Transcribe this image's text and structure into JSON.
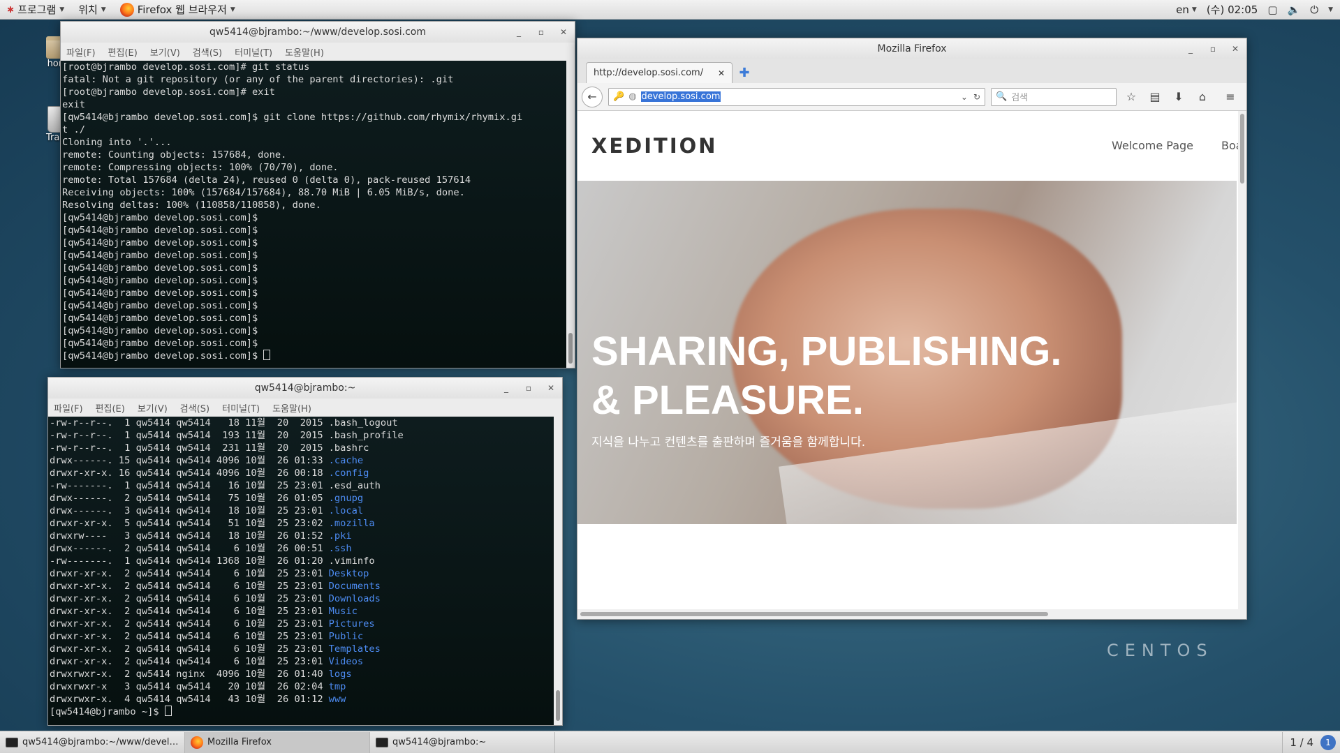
{
  "top_panel": {
    "applications": "프로그램",
    "places": "위치",
    "active_app": "Firefox 웹 브라우저",
    "lang": "en",
    "clock": "(수) 02:05"
  },
  "desktop": {
    "home_label": "home",
    "trash_label": "Trash",
    "centos": "CENTOS"
  },
  "terminal1": {
    "title": "qw5414@bjrambo:~/www/develop.sosi.com",
    "menu": [
      "파일(F)",
      "편집(E)",
      "보기(V)",
      "검색(S)",
      "터미널(T)",
      "도움말(H)"
    ],
    "lines": [
      "[root@bjrambo develop.sosi.com]# git status",
      "fatal: Not a git repository (or any of the parent directories): .git",
      "[root@bjrambo develop.sosi.com]# exit",
      "exit",
      "[qw5414@bjrambo develop.sosi.com]$ git clone https://github.com/rhymix/rhymix.gi",
      "t ./",
      "Cloning into '.'...",
      "remote: Counting objects: 157684, done.",
      "remote: Compressing objects: 100% (70/70), done.",
      "remote: Total 157684 (delta 24), reused 0 (delta 0), pack-reused 157614",
      "Receiving objects: 100% (157684/157684), 88.70 MiB | 6.05 MiB/s, done.",
      "Resolving deltas: 100% (110858/110858), done.",
      "[qw5414@bjrambo develop.sosi.com]$",
      "[qw5414@bjrambo develop.sosi.com]$",
      "[qw5414@bjrambo develop.sosi.com]$",
      "[qw5414@bjrambo develop.sosi.com]$",
      "[qw5414@bjrambo develop.sosi.com]$",
      "[qw5414@bjrambo develop.sosi.com]$",
      "[qw5414@bjrambo develop.sosi.com]$",
      "[qw5414@bjrambo develop.sosi.com]$",
      "[qw5414@bjrambo develop.sosi.com]$",
      "[qw5414@bjrambo develop.sosi.com]$",
      "[qw5414@bjrambo develop.sosi.com]$",
      "[qw5414@bjrambo develop.sosi.com]$ "
    ]
  },
  "terminal2": {
    "title": "qw5414@bjrambo:~",
    "menu": [
      "파일(F)",
      "편집(E)",
      "보기(V)",
      "검색(S)",
      "터미널(T)",
      "도움말(H)"
    ],
    "ls_rows": [
      {
        "meta": "-rw-r--r--.  1 qw5414 qw5414   18 11월  20  2015",
        "name": ".bash_logout",
        "dir": false
      },
      {
        "meta": "-rw-r--r--.  1 qw5414 qw5414  193 11월  20  2015",
        "name": ".bash_profile",
        "dir": false
      },
      {
        "meta": "-rw-r--r--.  1 qw5414 qw5414  231 11월  20  2015",
        "name": ".bashrc",
        "dir": false
      },
      {
        "meta": "drwx------. 15 qw5414 qw5414 4096 10월  26 01:33",
        "name": ".cache",
        "dir": true
      },
      {
        "meta": "drwxr-xr-x. 16 qw5414 qw5414 4096 10월  26 00:18",
        "name": ".config",
        "dir": true
      },
      {
        "meta": "-rw-------.  1 qw5414 qw5414   16 10월  25 23:01",
        "name": ".esd_auth",
        "dir": false
      },
      {
        "meta": "drwx------.  2 qw5414 qw5414   75 10월  26 01:05",
        "name": ".gnupg",
        "dir": true
      },
      {
        "meta": "drwx------.  3 qw5414 qw5414   18 10월  25 23:01",
        "name": ".local",
        "dir": true
      },
      {
        "meta": "drwxr-xr-x.  5 qw5414 qw5414   51 10월  25 23:02",
        "name": ".mozilla",
        "dir": true
      },
      {
        "meta": "drwxrw----   3 qw5414 qw5414   18 10월  26 01:52",
        "name": ".pki",
        "dir": true
      },
      {
        "meta": "drwx------.  2 qw5414 qw5414    6 10월  26 00:51",
        "name": ".ssh",
        "dir": true
      },
      {
        "meta": "-rw-------.  1 qw5414 qw5414 1368 10월  26 01:20",
        "name": ".viminfo",
        "dir": false
      },
      {
        "meta": "drwxr-xr-x.  2 qw5414 qw5414    6 10월  25 23:01",
        "name": "Desktop",
        "dir": true
      },
      {
        "meta": "drwxr-xr-x.  2 qw5414 qw5414    6 10월  25 23:01",
        "name": "Documents",
        "dir": true
      },
      {
        "meta": "drwxr-xr-x.  2 qw5414 qw5414    6 10월  25 23:01",
        "name": "Downloads",
        "dir": true
      },
      {
        "meta": "drwxr-xr-x.  2 qw5414 qw5414    6 10월  25 23:01",
        "name": "Music",
        "dir": true
      },
      {
        "meta": "drwxr-xr-x.  2 qw5414 qw5414    6 10월  25 23:01",
        "name": "Pictures",
        "dir": true
      },
      {
        "meta": "drwxr-xr-x.  2 qw5414 qw5414    6 10월  25 23:01",
        "name": "Public",
        "dir": true
      },
      {
        "meta": "drwxr-xr-x.  2 qw5414 qw5414    6 10월  25 23:01",
        "name": "Templates",
        "dir": true
      },
      {
        "meta": "drwxr-xr-x.  2 qw5414 qw5414    6 10월  25 23:01",
        "name": "Videos",
        "dir": true
      },
      {
        "meta": "drwxrwxr-x.  2 qw5414 nginx  4096 10월  26 01:40",
        "name": "logs",
        "dir": true
      },
      {
        "meta": "drwxrwxr-x   3 qw5414 qw5414   20 10월  26 02:04",
        "name": "tmp",
        "dir": true
      },
      {
        "meta": "drwxrwxr-x.  4 qw5414 qw5414   43 10월  26 01:12",
        "name": "www",
        "dir": true
      }
    ],
    "prompt": "[qw5414@bjrambo ~]$ "
  },
  "firefox": {
    "title": "Mozilla Firefox",
    "tab_label": "http://develop.sosi.com/",
    "url": "develop.sosi.com",
    "search_placeholder": "검색",
    "site": {
      "logo": "XEDITION",
      "nav": [
        "Welcome Page",
        "Boa"
      ],
      "hero_line1": "SHARING, PUBLISHING.",
      "hero_line2": "& PLEASURE.",
      "hero_sub": "지식을 나누고 컨텐츠를 출판하며 즐거움을 함께합니다."
    }
  },
  "taskbar": {
    "items": [
      "qw5414@bjrambo:~/www/devel…",
      "Mozilla Firefox",
      "qw5414@bjrambo:~"
    ],
    "workspace": "1 / 4",
    "notification_count": "1"
  }
}
